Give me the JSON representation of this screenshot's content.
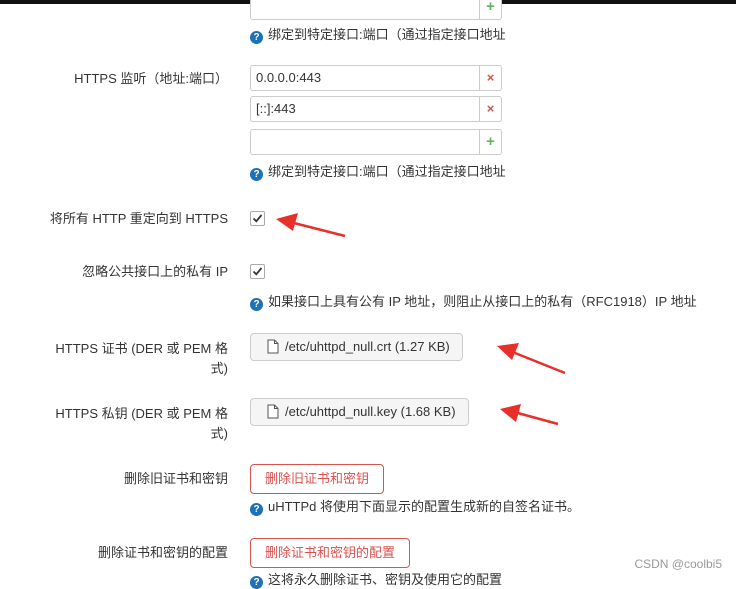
{
  "https_listen": {
    "top_help": "绑定到特定接口:端口（通过指定接口地址",
    "label": "HTTPS 监听（地址:端口）",
    "entries": [
      "0.0.0.0:443",
      "[::]:443"
    ],
    "new_entry": "",
    "help": "绑定到特定接口:端口（通过指定接口地址"
  },
  "redirect_https": {
    "label": "将所有 HTTP 重定向到 HTTPS",
    "checked": true
  },
  "ignore_private": {
    "label": "忽略公共接口上的私有 IP",
    "checked": true,
    "help": "如果接口上具有公有 IP 地址，则阻止从接口上的私有（RFC1918）IP 地址"
  },
  "https_cert": {
    "label_line1": "HTTPS 证书 (DER 或 PEM 格",
    "label_line2": "式)",
    "file": "/etc/uhttpd_null.crt (1.27 KB)"
  },
  "https_key": {
    "label_line1": "HTTPS 私钥 (DER 或 PEM 格",
    "label_line2": "式)",
    "file": "/etc/uhttpd_null.key (1.68 KB)"
  },
  "remove_old": {
    "label": "删除旧证书和密钥",
    "button": "删除旧证书和密钥",
    "help": "uHTTPd 将使用下面显示的配置生成新的自签名证书。"
  },
  "remove_conf": {
    "label": "删除证书和密钥的配置",
    "button": "删除证书和密钥的配置",
    "help": "这将永久删除证书、密钥及使用它的配置"
  },
  "watermark": "CSDN @coolbi5",
  "colors": {
    "danger": "#d9534f",
    "help_icon": "#1d71b8",
    "arrow": "#e8302a",
    "add": "#5cb85c"
  }
}
